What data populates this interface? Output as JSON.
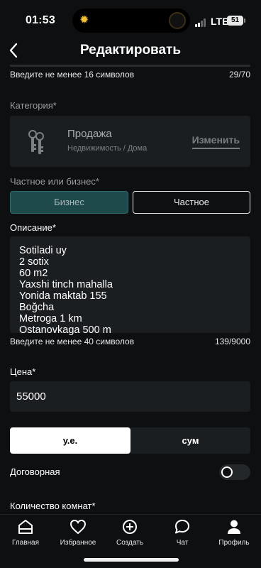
{
  "status_bar": {
    "time": "01:53",
    "carrier": "LTE",
    "battery": "51"
  },
  "header": {
    "title": "Редактировать"
  },
  "title_field": {
    "hint": "Введите не менее 16 символов",
    "count": "29/70"
  },
  "category": {
    "label": "Категория*",
    "name": "Продажа",
    "path": "Недвижимость / Дома",
    "change_label": "Изменить"
  },
  "seller_type": {
    "label": "Частное или бизнес*",
    "business": "Бизнес",
    "private": "Частное",
    "selected": "business"
  },
  "description": {
    "label": "Описание*",
    "text": "Sotiladi uy\n2 sotix\n60 m2\nYaxshi tinch mahalla\nYonida maktab 155\nBoğcha\nMetroga 1 km\nOstanovkaga 500 m",
    "hint": "Введите не менее 40 символов",
    "count": "139/9000"
  },
  "price": {
    "label": "Цена*",
    "value": "55000"
  },
  "currency": {
    "options": [
      "у.е.",
      "сум"
    ],
    "selected": "у.е."
  },
  "negotiable": {
    "label": "Договорная",
    "on": false
  },
  "rooms": {
    "label": "Количество комнат*"
  },
  "tabbar": {
    "items": [
      {
        "label": "Главная",
        "icon": "home-icon"
      },
      {
        "label": "Избранное",
        "icon": "heart-icon"
      },
      {
        "label": "Создать",
        "icon": "plus-circle-icon"
      },
      {
        "label": "Чат",
        "icon": "chat-icon"
      },
      {
        "label": "Профиль",
        "icon": "profile-icon"
      }
    ]
  },
  "colors": {
    "background": "#0d0f10",
    "field": "#1b1e21",
    "business_selected": "#1f4a4c"
  }
}
